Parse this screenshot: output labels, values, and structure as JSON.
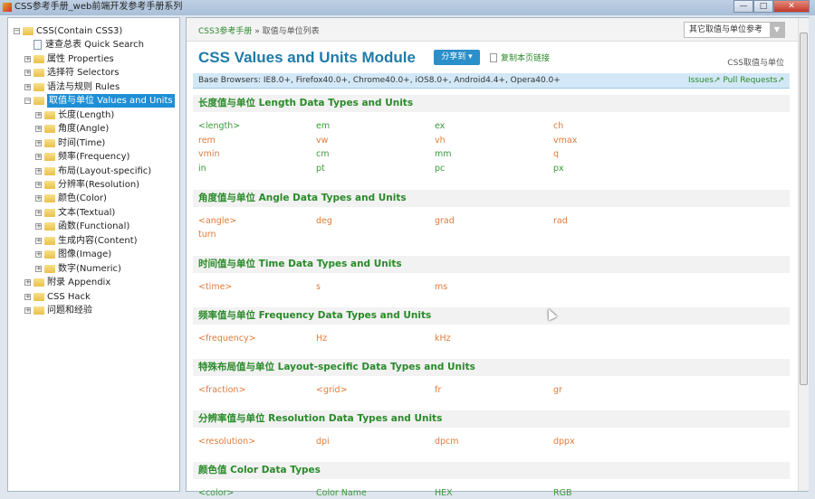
{
  "window": {
    "title": "CSS参考手册_web前端开发参考手册系列",
    "buttons": [
      "—",
      "□",
      "✕"
    ]
  },
  "sidebar": {
    "items": [
      {
        "label": "CSS(Contain CSS3)",
        "level": 0,
        "expander": "−",
        "type": "folder"
      },
      {
        "label": "速查总表 Quick Search",
        "level": 1,
        "expander": "",
        "type": "doc"
      },
      {
        "label": "属性 Properties",
        "level": 1,
        "expander": "+",
        "type": "folder"
      },
      {
        "label": "选择符 Selectors",
        "level": 1,
        "expander": "+",
        "type": "folder"
      },
      {
        "label": "语法与规则 Rules",
        "level": 1,
        "expander": "+",
        "type": "folder"
      },
      {
        "label": "取值与单位 Values and Units",
        "level": 1,
        "expander": "−",
        "type": "folder",
        "selected": true
      },
      {
        "label": "长度(Length)",
        "level": 2,
        "expander": "+",
        "type": "folder"
      },
      {
        "label": "角度(Angle)",
        "level": 2,
        "expander": "+",
        "type": "folder"
      },
      {
        "label": "时间(Time)",
        "level": 2,
        "expander": "+",
        "type": "folder"
      },
      {
        "label": "频率(Frequency)",
        "level": 2,
        "expander": "+",
        "type": "folder"
      },
      {
        "label": "布局(Layout-specific)",
        "level": 2,
        "expander": "+",
        "type": "folder"
      },
      {
        "label": "分辨率(Resolution)",
        "level": 2,
        "expander": "+",
        "type": "folder"
      },
      {
        "label": "颜色(Color)",
        "level": 2,
        "expander": "+",
        "type": "folder"
      },
      {
        "label": "文本(Textual)",
        "level": 2,
        "expander": "+",
        "type": "folder"
      },
      {
        "label": "函数(Functional)",
        "level": 2,
        "expander": "+",
        "type": "folder"
      },
      {
        "label": "生成内容(Content)",
        "level": 2,
        "expander": "+",
        "type": "folder"
      },
      {
        "label": "图像(Image)",
        "level": 2,
        "expander": "+",
        "type": "folder"
      },
      {
        "label": "数字(Numeric)",
        "level": 2,
        "expander": "+",
        "type": "folder"
      },
      {
        "label": "附录 Appendix",
        "level": 1,
        "expander": "+",
        "type": "folder"
      },
      {
        "label": "CSS Hack",
        "level": 1,
        "expander": "+",
        "type": "folder"
      },
      {
        "label": "问题和经验",
        "level": 1,
        "expander": "+",
        "type": "folder"
      }
    ]
  },
  "breadcrumb": {
    "home": "CSS3参考手册",
    "sep": " » ",
    "current": "取值与单位列表"
  },
  "other_select": {
    "value": "其它取值与单位参考",
    "arrow": "▼"
  },
  "header": {
    "title": "CSS Values and Units Module",
    "share": "分享到 ▾",
    "copy_link": "复制本页链接",
    "subtitle": "CSS取值与单位"
  },
  "browsers": {
    "text": "Base Browsers: IE8.0+, Firefox40.0+, Chrome40.0+, iOS8.0+, Android4.4+, Opera40.0+",
    "issues": "Issues↗",
    "pull_requests": "Pull Requests↗"
  },
  "colors": {
    "green": "#3a9a3a",
    "orange": "#e07b39",
    "accent": "#1f7ba8"
  },
  "sections": [
    {
      "title": "长度值与单位 Length Data Types and Units",
      "items": [
        [
          "<length>",
          "g"
        ],
        [
          "em",
          "g"
        ],
        [
          "ex",
          "g"
        ],
        [
          "ch",
          "o"
        ],
        [
          "rem",
          "o"
        ],
        [
          "vw",
          "o"
        ],
        [
          "vh",
          "o"
        ],
        [
          "vmax",
          "o"
        ],
        [
          "vmin",
          "o"
        ],
        [
          "cm",
          "g"
        ],
        [
          "mm",
          "g"
        ],
        [
          "q",
          "o"
        ],
        [
          "in",
          "g"
        ],
        [
          "pt",
          "g"
        ],
        [
          "pc",
          "g"
        ],
        [
          "px",
          "g"
        ]
      ]
    },
    {
      "title": "角度值与单位 Angle Data Types and Units",
      "items": [
        [
          "<angle>",
          "o"
        ],
        [
          "deg",
          "o"
        ],
        [
          "grad",
          "o"
        ],
        [
          "rad",
          "o"
        ],
        [
          "turn",
          "o"
        ]
      ]
    },
    {
      "title": "时间值与单位 Time Data Types and Units",
      "items": [
        [
          "<time>",
          "o"
        ],
        [
          "s",
          "o"
        ],
        [
          "ms",
          "o"
        ]
      ]
    },
    {
      "title": "频率值与单位 Frequency Data Types and Units",
      "items": [
        [
          "<frequency>",
          "o"
        ],
        [
          "Hz",
          "o"
        ],
        [
          "kHz",
          "o"
        ]
      ]
    },
    {
      "title": "特殊布局值与单位 Layout-specific Data Types and Units",
      "items": [
        [
          "<fraction>",
          "o"
        ],
        [
          "<grid>",
          "o"
        ],
        [
          "fr",
          "o"
        ],
        [
          "gr",
          "o"
        ]
      ]
    },
    {
      "title": "分辨率值与单位 Resolution Data Types and Units",
      "items": [
        [
          "<resolution>",
          "o"
        ],
        [
          "dpi",
          "o"
        ],
        [
          "dpcm",
          "o"
        ],
        [
          "dppx",
          "o"
        ]
      ]
    },
    {
      "title": "颜色值 Color Data Types",
      "items": [
        [
          "<color>",
          "g"
        ],
        [
          "Color Name",
          "g"
        ],
        [
          "HEX",
          "g"
        ],
        [
          "RGB",
          "g"
        ]
      ]
    }
  ]
}
